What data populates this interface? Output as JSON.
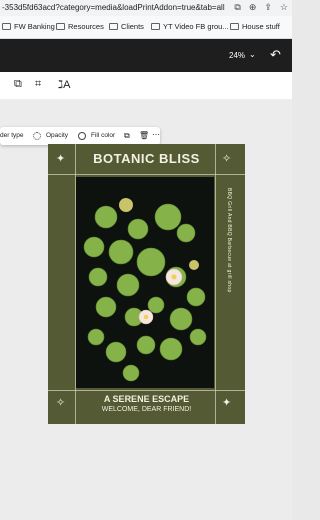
{
  "browser": {
    "url": "-353d5fd63acd?category=media&loadPrintAddon=true&tab=all",
    "icons": [
      "extension-icon",
      "zoom-icon",
      "share-icon",
      "star-icon"
    ]
  },
  "bookmarks": [
    {
      "label": "FW Banking"
    },
    {
      "label": "Resources"
    },
    {
      "label": "Clients"
    },
    {
      "label": "YT Video FB grou..."
    },
    {
      "label": "House stuff"
    }
  ],
  "topbar": {
    "zoom": "24%",
    "chevron": "⌄",
    "undo": "↶"
  },
  "toolrow": {
    "icons": [
      "link-icon",
      "crop-icon",
      "translate-icon"
    ]
  },
  "context_menu": {
    "border_type": "der type",
    "opacity": "Opacity",
    "fill_color": "Fill color"
  },
  "poster": {
    "title": "BOTANIC BLISS",
    "vertical_text": "BBQ Grill And BBQ Barbecue at grill shop",
    "subtitle": "A SERENE ESCAPE",
    "welcome": "WELCOME, DEAR FRIEND!",
    "sparkle": "✦",
    "colors": {
      "frame": "#545a33",
      "text": "#f4f1e4",
      "photo_bg": "#0e1410",
      "pad": "#7fae46",
      "flower": "#f4e7e0"
    }
  }
}
